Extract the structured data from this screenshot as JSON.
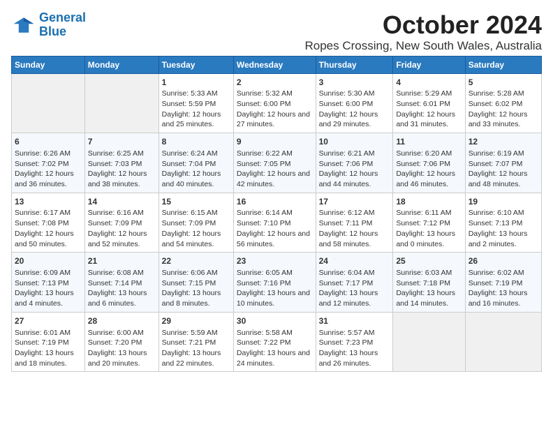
{
  "logo": {
    "line1": "General",
    "line2": "Blue"
  },
  "title": "October 2024",
  "subtitle": "Ropes Crossing, New South Wales, Australia",
  "headers": [
    "Sunday",
    "Monday",
    "Tuesday",
    "Wednesday",
    "Thursday",
    "Friday",
    "Saturday"
  ],
  "weeks": [
    [
      {
        "day": "",
        "sunrise": "",
        "sunset": "",
        "daylight": ""
      },
      {
        "day": "",
        "sunrise": "",
        "sunset": "",
        "daylight": ""
      },
      {
        "day": "1",
        "sunrise": "Sunrise: 5:33 AM",
        "sunset": "Sunset: 5:59 PM",
        "daylight": "Daylight: 12 hours and 25 minutes."
      },
      {
        "day": "2",
        "sunrise": "Sunrise: 5:32 AM",
        "sunset": "Sunset: 6:00 PM",
        "daylight": "Daylight: 12 hours and 27 minutes."
      },
      {
        "day": "3",
        "sunrise": "Sunrise: 5:30 AM",
        "sunset": "Sunset: 6:00 PM",
        "daylight": "Daylight: 12 hours and 29 minutes."
      },
      {
        "day": "4",
        "sunrise": "Sunrise: 5:29 AM",
        "sunset": "Sunset: 6:01 PM",
        "daylight": "Daylight: 12 hours and 31 minutes."
      },
      {
        "day": "5",
        "sunrise": "Sunrise: 5:28 AM",
        "sunset": "Sunset: 6:02 PM",
        "daylight": "Daylight: 12 hours and 33 minutes."
      }
    ],
    [
      {
        "day": "6",
        "sunrise": "Sunrise: 6:26 AM",
        "sunset": "Sunset: 7:02 PM",
        "daylight": "Daylight: 12 hours and 36 minutes."
      },
      {
        "day": "7",
        "sunrise": "Sunrise: 6:25 AM",
        "sunset": "Sunset: 7:03 PM",
        "daylight": "Daylight: 12 hours and 38 minutes."
      },
      {
        "day": "8",
        "sunrise": "Sunrise: 6:24 AM",
        "sunset": "Sunset: 7:04 PM",
        "daylight": "Daylight: 12 hours and 40 minutes."
      },
      {
        "day": "9",
        "sunrise": "Sunrise: 6:22 AM",
        "sunset": "Sunset: 7:05 PM",
        "daylight": "Daylight: 12 hours and 42 minutes."
      },
      {
        "day": "10",
        "sunrise": "Sunrise: 6:21 AM",
        "sunset": "Sunset: 7:06 PM",
        "daylight": "Daylight: 12 hours and 44 minutes."
      },
      {
        "day": "11",
        "sunrise": "Sunrise: 6:20 AM",
        "sunset": "Sunset: 7:06 PM",
        "daylight": "Daylight: 12 hours and 46 minutes."
      },
      {
        "day": "12",
        "sunrise": "Sunrise: 6:19 AM",
        "sunset": "Sunset: 7:07 PM",
        "daylight": "Daylight: 12 hours and 48 minutes."
      }
    ],
    [
      {
        "day": "13",
        "sunrise": "Sunrise: 6:17 AM",
        "sunset": "Sunset: 7:08 PM",
        "daylight": "Daylight: 12 hours and 50 minutes."
      },
      {
        "day": "14",
        "sunrise": "Sunrise: 6:16 AM",
        "sunset": "Sunset: 7:09 PM",
        "daylight": "Daylight: 12 hours and 52 minutes."
      },
      {
        "day": "15",
        "sunrise": "Sunrise: 6:15 AM",
        "sunset": "Sunset: 7:09 PM",
        "daylight": "Daylight: 12 hours and 54 minutes."
      },
      {
        "day": "16",
        "sunrise": "Sunrise: 6:14 AM",
        "sunset": "Sunset: 7:10 PM",
        "daylight": "Daylight: 12 hours and 56 minutes."
      },
      {
        "day": "17",
        "sunrise": "Sunrise: 6:12 AM",
        "sunset": "Sunset: 7:11 PM",
        "daylight": "Daylight: 12 hours and 58 minutes."
      },
      {
        "day": "18",
        "sunrise": "Sunrise: 6:11 AM",
        "sunset": "Sunset: 7:12 PM",
        "daylight": "Daylight: 13 hours and 0 minutes."
      },
      {
        "day": "19",
        "sunrise": "Sunrise: 6:10 AM",
        "sunset": "Sunset: 7:13 PM",
        "daylight": "Daylight: 13 hours and 2 minutes."
      }
    ],
    [
      {
        "day": "20",
        "sunrise": "Sunrise: 6:09 AM",
        "sunset": "Sunset: 7:13 PM",
        "daylight": "Daylight: 13 hours and 4 minutes."
      },
      {
        "day": "21",
        "sunrise": "Sunrise: 6:08 AM",
        "sunset": "Sunset: 7:14 PM",
        "daylight": "Daylight: 13 hours and 6 minutes."
      },
      {
        "day": "22",
        "sunrise": "Sunrise: 6:06 AM",
        "sunset": "Sunset: 7:15 PM",
        "daylight": "Daylight: 13 hours and 8 minutes."
      },
      {
        "day": "23",
        "sunrise": "Sunrise: 6:05 AM",
        "sunset": "Sunset: 7:16 PM",
        "daylight": "Daylight: 13 hours and 10 minutes."
      },
      {
        "day": "24",
        "sunrise": "Sunrise: 6:04 AM",
        "sunset": "Sunset: 7:17 PM",
        "daylight": "Daylight: 13 hours and 12 minutes."
      },
      {
        "day": "25",
        "sunrise": "Sunrise: 6:03 AM",
        "sunset": "Sunset: 7:18 PM",
        "daylight": "Daylight: 13 hours and 14 minutes."
      },
      {
        "day": "26",
        "sunrise": "Sunrise: 6:02 AM",
        "sunset": "Sunset: 7:19 PM",
        "daylight": "Daylight: 13 hours and 16 minutes."
      }
    ],
    [
      {
        "day": "27",
        "sunrise": "Sunrise: 6:01 AM",
        "sunset": "Sunset: 7:19 PM",
        "daylight": "Daylight: 13 hours and 18 minutes."
      },
      {
        "day": "28",
        "sunrise": "Sunrise: 6:00 AM",
        "sunset": "Sunset: 7:20 PM",
        "daylight": "Daylight: 13 hours and 20 minutes."
      },
      {
        "day": "29",
        "sunrise": "Sunrise: 5:59 AM",
        "sunset": "Sunset: 7:21 PM",
        "daylight": "Daylight: 13 hours and 22 minutes."
      },
      {
        "day": "30",
        "sunrise": "Sunrise: 5:58 AM",
        "sunset": "Sunset: 7:22 PM",
        "daylight": "Daylight: 13 hours and 24 minutes."
      },
      {
        "day": "31",
        "sunrise": "Sunrise: 5:57 AM",
        "sunset": "Sunset: 7:23 PM",
        "daylight": "Daylight: 13 hours and 26 minutes."
      },
      {
        "day": "",
        "sunrise": "",
        "sunset": "",
        "daylight": ""
      },
      {
        "day": "",
        "sunrise": "",
        "sunset": "",
        "daylight": ""
      }
    ]
  ]
}
